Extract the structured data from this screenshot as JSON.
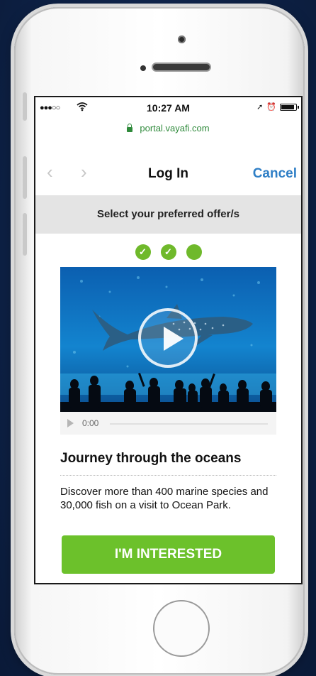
{
  "status_bar": {
    "signal": "●●●○○",
    "time": "10:27 AM"
  },
  "browser": {
    "url": "portal.vayafi.com"
  },
  "nav": {
    "back": "‹",
    "forward": "›",
    "title": "Log In",
    "cancel_label": "Cancel"
  },
  "banner": {
    "text": "Select your preferred offer/s"
  },
  "steps": [
    {
      "mark": "✓"
    },
    {
      "mark": "✓"
    },
    {
      "mark": ""
    }
  ],
  "video": {
    "time": "0:00"
  },
  "offer": {
    "title": "Journey through the oceans",
    "description": "Discover more than 400 marine species and 30,000 fish on a visit to Ocean Park.",
    "cta_label": "I'M INTERESTED"
  },
  "colors": {
    "background": "#0e2247",
    "accent_green": "#6cc12b",
    "url_green": "#2f8a3b",
    "link_blue": "#2f7fc6",
    "banner_gray": "#e4e4e4"
  }
}
